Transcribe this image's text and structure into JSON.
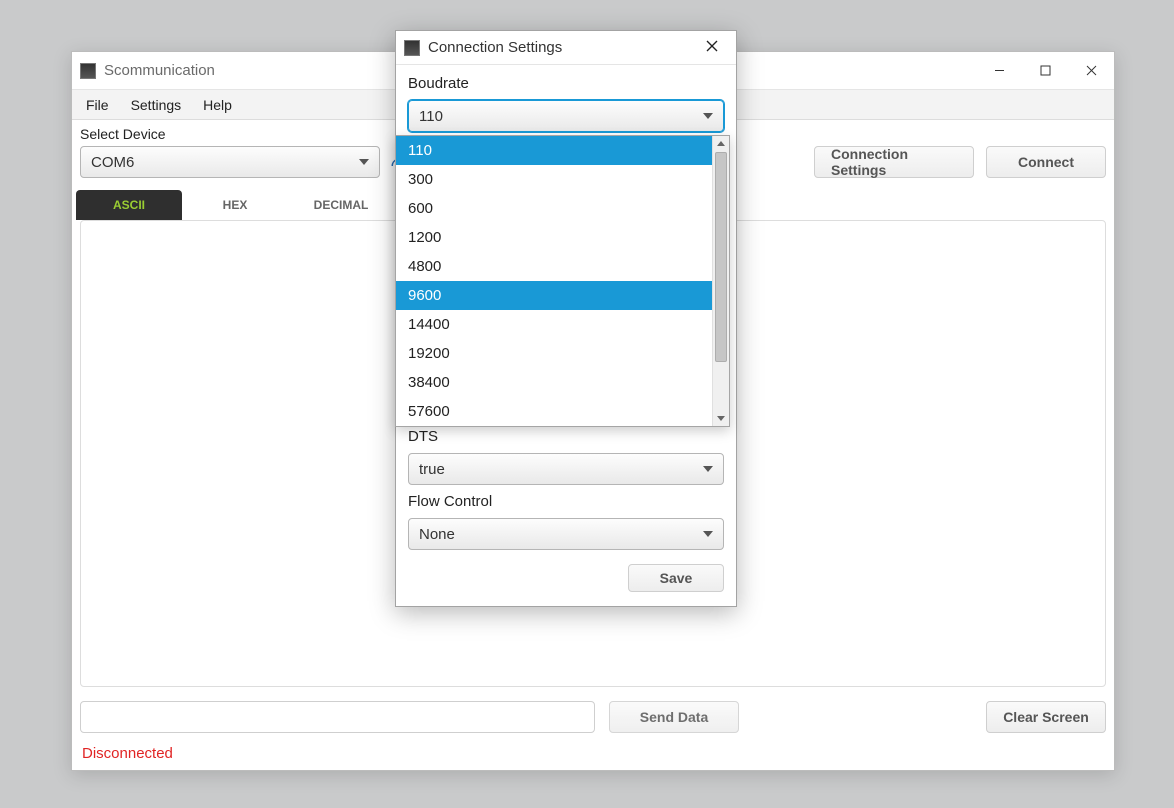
{
  "main": {
    "title": "Scommunication",
    "menu": {
      "file": "File",
      "settings": "Settings",
      "help": "Help"
    },
    "device_label": "Select Device",
    "device_value": "COM6",
    "conn_settings_btn": "Connection Settings",
    "connect_btn": "Connect",
    "tabs": {
      "ascii": "ASCII",
      "hex": "HEX",
      "decimal": "DECIMAL"
    },
    "send_btn": "Send Data",
    "clear_btn": "Clear Screen",
    "status": "Disconnected"
  },
  "dialog": {
    "title": "Connection Settings",
    "baud_label": "Boudrate",
    "baud_value": "110",
    "baud_options": [
      "110",
      "300",
      "600",
      "1200",
      "4800",
      "9600",
      "14400",
      "19200",
      "38400",
      "57600"
    ],
    "baud_highlight_index": 5,
    "baud_selected_index": 0,
    "dts_label": "DTS",
    "dts_value": "true",
    "flow_label": "Flow Control",
    "flow_value": "None",
    "save_btn": "Save"
  }
}
